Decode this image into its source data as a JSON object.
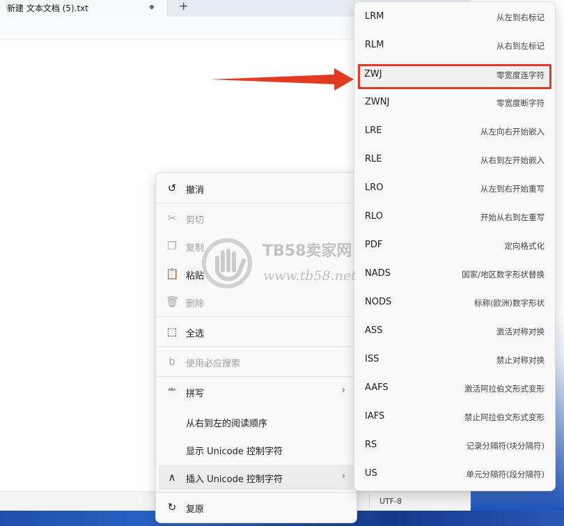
{
  "tab": {
    "title": "新建 文本文档 (5).txt",
    "add_label": "+"
  },
  "status": {
    "encoding": "UTF-8"
  },
  "context_menu": {
    "items": [
      {
        "label": "撤消",
        "icon": "undo-icon",
        "glyph": "↺",
        "disabled": false
      },
      {
        "label": "剪切",
        "icon": "scissors-icon",
        "glyph": "✂",
        "disabled": true
      },
      {
        "label": "复制",
        "icon": "copy-icon",
        "glyph": "❐",
        "disabled": true
      },
      {
        "label": "粘贴",
        "icon": "clipboard-icon",
        "glyph": "📋",
        "disabled": false
      },
      {
        "label": "删除",
        "icon": "trash-icon",
        "glyph": "🗑",
        "disabled": true
      },
      {
        "label": "全选",
        "icon": "select-all-icon",
        "glyph": "⬚",
        "disabled": false
      },
      {
        "label": "使用必应搜索",
        "icon": "bing-icon",
        "glyph": "b",
        "disabled": true
      },
      {
        "label": "拼写",
        "icon": "spellcheck-icon",
        "glyph": "ᴬᴮᶜ",
        "disabled": false,
        "submenu": true
      },
      {
        "label": "从右到左的阅读顺序",
        "icon": "",
        "glyph": "",
        "disabled": false
      },
      {
        "label": "显示 Unicode 控制字符",
        "icon": "",
        "glyph": "",
        "disabled": false
      },
      {
        "label": "插入 Unicode 控制字符",
        "icon": "insert-caret-icon",
        "glyph": "∧",
        "disabled": false,
        "submenu": true,
        "hover": true
      },
      {
        "label": "复原",
        "icon": "redo-icon",
        "glyph": "↻",
        "disabled": false
      }
    ]
  },
  "unicode_submenu": {
    "items": [
      {
        "code": "LRM",
        "desc": "从左到右标记"
      },
      {
        "code": "RLM",
        "desc": "从右到左标记"
      },
      {
        "code": "ZWJ",
        "desc": "零宽度连字符",
        "selected": true
      },
      {
        "code": "ZWNJ",
        "desc": "零宽度断字符"
      },
      {
        "code": "LRE",
        "desc": "从左向右开始嵌入"
      },
      {
        "code": "RLE",
        "desc": "从右到左开始嵌入"
      },
      {
        "code": "LRO",
        "desc": "从左到右开始重写"
      },
      {
        "code": "RLO",
        "desc": "开始从右到左重写"
      },
      {
        "code": "PDF",
        "desc": "定向格式化"
      },
      {
        "code": "NADS",
        "desc": "国家/地区数字形状替换"
      },
      {
        "code": "NODS",
        "desc": "标称(欧洲)数字形状"
      },
      {
        "code": "ASS",
        "desc": "激活对称对换"
      },
      {
        "code": "ISS",
        "desc": "禁止对称对换"
      },
      {
        "code": "AAFS",
        "desc": "激活阿拉伯文形式变形"
      },
      {
        "code": "IAFS",
        "desc": "禁止阿拉伯文形式变形"
      },
      {
        "code": "RS",
        "desc": "记录分隔符(块分隔符)"
      },
      {
        "code": "US",
        "desc": "单元分隔符(段分隔符)"
      }
    ]
  },
  "watermark": {
    "brand": "TB58卖家网",
    "url": "www.tb58.net"
  },
  "colors": {
    "highlight_border": "#e33a22",
    "arrow": "#e33a22"
  }
}
